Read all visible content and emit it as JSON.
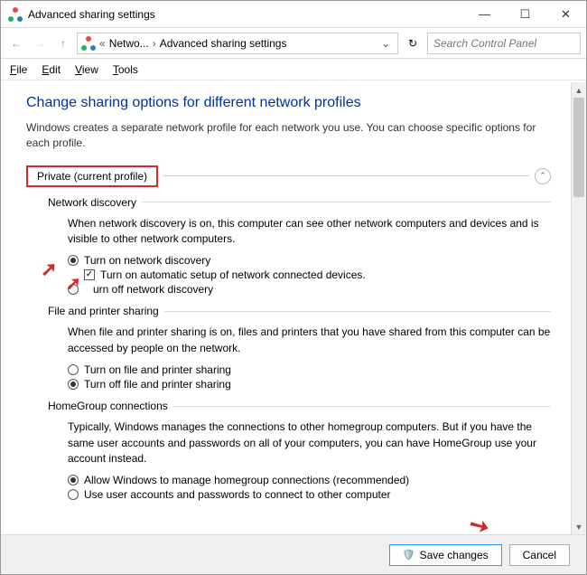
{
  "window": {
    "title": "Advanced sharing settings"
  },
  "nav": {
    "breadcrumb1": "Netwo...",
    "breadcrumb2": "Advanced sharing settings",
    "search_placeholder": "Search Control Panel"
  },
  "menu": {
    "file": "File",
    "edit": "Edit",
    "view": "View",
    "tools": "Tools"
  },
  "page": {
    "title": "Change sharing options for different network profiles",
    "desc": "Windows creates a separate network profile for each network you use. You can choose specific options for each profile.",
    "profile": "Private (current profile)"
  },
  "netdisc": {
    "title": "Network discovery",
    "desc": "When network discovery is on, this computer can see other network computers and devices and is visible to other network computers.",
    "opt_on": "Turn on network discovery",
    "opt_auto": "Turn on automatic setup of network connected devices.",
    "opt_off": "urn off network discovery"
  },
  "fps": {
    "title": "File and printer sharing",
    "desc": "When file and printer sharing is on, files and printers that you have shared from this computer can be accessed by people on the network.",
    "opt_on": "Turn on file and printer sharing",
    "opt_off": "Turn off file and printer sharing"
  },
  "hg": {
    "title": "HomeGroup connections",
    "desc": "Typically, Windows manages the connections to other homegroup computers. But if you have the same user accounts and passwords on all of your computers, you can have HomeGroup use your account instead.",
    "opt_allow": "Allow Windows to manage homegroup connections (recommended)",
    "opt_user": "Use user accounts and passwords to connect to other computer"
  },
  "footer": {
    "save": "Save changes",
    "cancel": "Cancel"
  }
}
